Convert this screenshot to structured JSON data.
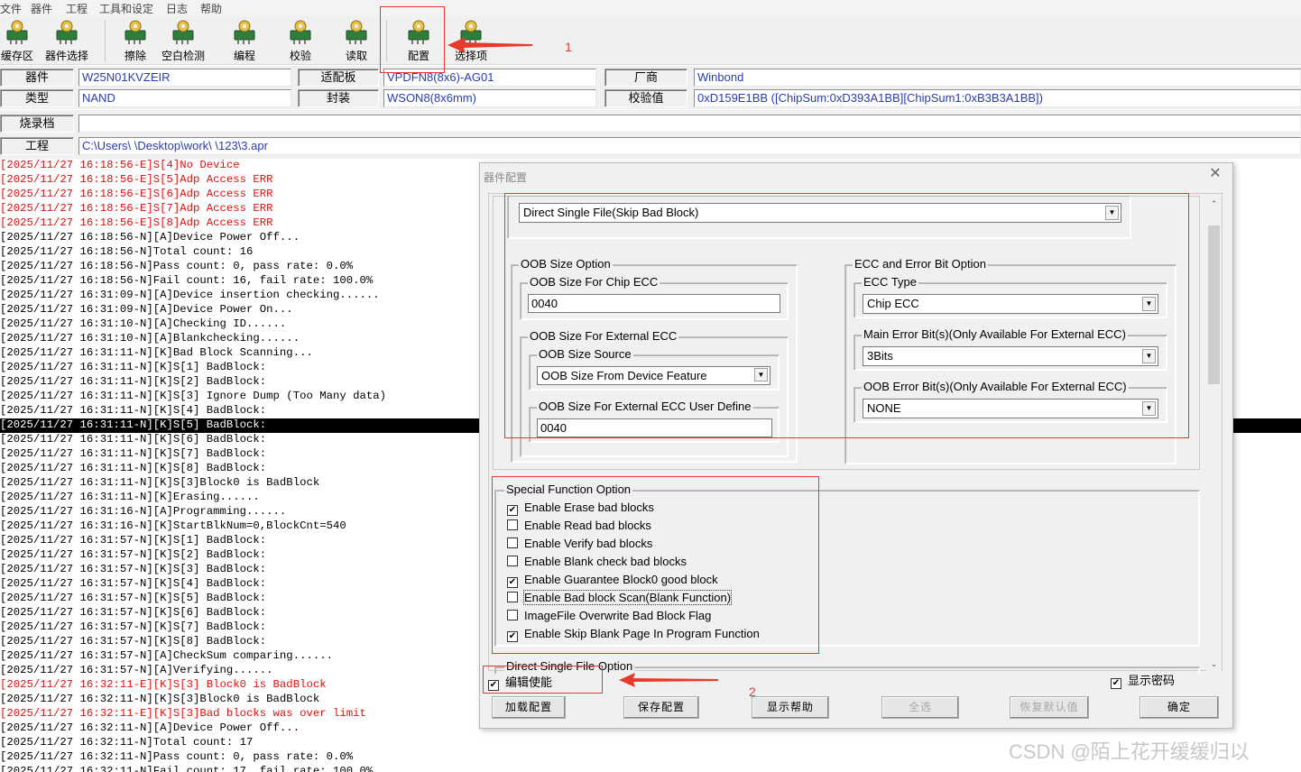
{
  "menubar": [
    "文件",
    "器件",
    "工程",
    "工具和设定",
    "日志",
    "帮助"
  ],
  "toolbar": [
    {
      "label": "缓存区",
      "icon": "buffer-icon"
    },
    {
      "label": "器件选择",
      "icon": "device-select-icon"
    },
    {
      "label": "擦除",
      "icon": "erase-icon"
    },
    {
      "label": "空白检测",
      "icon": "blank-check-icon"
    },
    {
      "label": "编程",
      "icon": "program-icon"
    },
    {
      "label": "校验",
      "icon": "verify-icon"
    },
    {
      "label": "读取",
      "icon": "read-icon"
    },
    {
      "label": "配置",
      "icon": "config-icon"
    },
    {
      "label": "选择项",
      "icon": "options-icon"
    }
  ],
  "info": {
    "device_label": "器件",
    "device_value": "W25N01KVZEIR",
    "adapter_label": "适配板",
    "adapter_value": "VPDFN8(8x6)-AG01",
    "maker_label": "厂商",
    "maker_value": "Winbond",
    "type_label": "类型",
    "type_value": "NAND",
    "package_label": "封装",
    "package_value": "WSON8(8x6mm)",
    "checksum_label": "校验值",
    "checksum_value": "0xD159E1BB    ([ChipSum:0xD393A1BB][ChipSum1:0xB3B3A1BB])",
    "burnfile_label": "烧录档",
    "project_label": "工程",
    "project_value": "C:\\Users\\      \\Desktop\\work\\      \\123\\3.apr"
  },
  "log": [
    {
      "t": "[2025/11/27 16:18:56-E]S[4]No Device",
      "k": "err"
    },
    {
      "t": "[2025/11/27 16:18:56-E]S[5]Adp Access ERR",
      "k": "err"
    },
    {
      "t": "[2025/11/27 16:18:56-E]S[6]Adp Access ERR",
      "k": "err"
    },
    {
      "t": "[2025/11/27 16:18:56-E]S[7]Adp Access ERR",
      "k": "err"
    },
    {
      "t": "[2025/11/27 16:18:56-E]S[8]Adp Access ERR",
      "k": "err"
    },
    {
      "t": "[2025/11/27 16:18:56-N][A]Device Power Off...",
      "k": ""
    },
    {
      "t": "[2025/11/27 16:18:56-N]Total count: 16",
      "k": ""
    },
    {
      "t": "[2025/11/27 16:18:56-N]Pass count: 0, pass rate: 0.0%",
      "k": ""
    },
    {
      "t": "[2025/11/27 16:18:56-N]Fail count: 16, fail rate: 100.0%",
      "k": ""
    },
    {
      "t": "[2025/11/27 16:31:09-N][A]Device insertion checking......",
      "k": ""
    },
    {
      "t": "[2025/11/27 16:31:09-N][A]Device Power On...",
      "k": ""
    },
    {
      "t": "[2025/11/27 16:31:10-N][A]Checking ID......",
      "k": ""
    },
    {
      "t": "[2025/11/27 16:31:10-N][A]Blankchecking......",
      "k": ""
    },
    {
      "t": "[2025/11/27 16:31:11-N][K]Bad Block Scanning...",
      "k": ""
    },
    {
      "t": "[2025/11/27 16:31:11-N][K]S[1] BadBlock:",
      "k": ""
    },
    {
      "t": "[2025/11/27 16:31:11-N][K]S[2] BadBlock:",
      "k": ""
    },
    {
      "t": "[2025/11/27 16:31:11-N][K]S[3] Ignore Dump (Too Many data)",
      "k": ""
    },
    {
      "t": "[2025/11/27 16:31:11-N][K]S[4] BadBlock:",
      "k": ""
    },
    {
      "t": "[2025/11/27 16:31:11-N][K]S[5] BadBlock:",
      "k": "sel"
    },
    {
      "t": "[2025/11/27 16:31:11-N][K]S[6] BadBlock:",
      "k": ""
    },
    {
      "t": "[2025/11/27 16:31:11-N][K]S[7] BadBlock:",
      "k": ""
    },
    {
      "t": "[2025/11/27 16:31:11-N][K]S[8] BadBlock:",
      "k": ""
    },
    {
      "t": "[2025/11/27 16:31:11-N][K]S[3]Block0 is BadBlock",
      "k": ""
    },
    {
      "t": "[2025/11/27 16:31:11-N][K]Erasing......",
      "k": ""
    },
    {
      "t": "[2025/11/27 16:31:16-N][A]Programming......",
      "k": ""
    },
    {
      "t": "[2025/11/27 16:31:16-N][K]StartBlkNum=0,BlockCnt=540",
      "k": ""
    },
    {
      "t": "[2025/11/27 16:31:57-N][K]S[1] BadBlock:",
      "k": ""
    },
    {
      "t": "[2025/11/27 16:31:57-N][K]S[2] BadBlock:",
      "k": ""
    },
    {
      "t": "[2025/11/27 16:31:57-N][K]S[3] BadBlock:",
      "k": ""
    },
    {
      "t": "[2025/11/27 16:31:57-N][K]S[4] BadBlock:",
      "k": ""
    },
    {
      "t": "[2025/11/27 16:31:57-N][K]S[5] BadBlock:",
      "k": ""
    },
    {
      "t": "[2025/11/27 16:31:57-N][K]S[6] BadBlock:",
      "k": ""
    },
    {
      "t": "[2025/11/27 16:31:57-N][K]S[7] BadBlock:",
      "k": ""
    },
    {
      "t": "[2025/11/27 16:31:57-N][K]S[8] BadBlock:",
      "k": ""
    },
    {
      "t": "[2025/11/27 16:31:57-N][A]CheckSum comparing......",
      "k": ""
    },
    {
      "t": "[2025/11/27 16:31:57-N][A]Verifying......",
      "k": ""
    },
    {
      "t": "[2025/11/27 16:32:11-E][K]S[3] Block0 is BadBlock",
      "k": "err"
    },
    {
      "t": "[2025/11/27 16:32:11-N][K]S[3]Block0 is BadBlock",
      "k": ""
    },
    {
      "t": "[2025/11/27 16:32:11-E][K]S[3]Bad blocks was over limit",
      "k": "err"
    },
    {
      "t": "[2025/11/27 16:32:11-N][A]Device Power Off...",
      "k": ""
    },
    {
      "t": "[2025/11/27 16:32:11-N]Total count: 17",
      "k": ""
    },
    {
      "t": "[2025/11/27 16:32:11-N]Pass count: 0, pass rate: 0.0%",
      "k": ""
    },
    {
      "t": "[2025/11/27 16:32:11-N]Fail count: 17, fail rate: 100.0%",
      "k": ""
    }
  ],
  "dialog": {
    "title": "器件配置",
    "close": "✕",
    "program_mode": "Direct Single File(Skip Bad Block)",
    "oob": {
      "title": "OOB Size Option",
      "chip_ecc_title": "OOB Size For Chip ECC",
      "chip_ecc_value": "0040",
      "ext_title": "OOB Size For External ECC",
      "source_title": "OOB Size Source",
      "source_value": "OOB Size From Device Feature",
      "user_title": "OOB Size For External ECC User Define",
      "user_value": "0040"
    },
    "ecc": {
      "title": "ECC and Error Bit Option",
      "type_title": "ECC Type",
      "type_value": "Chip ECC",
      "main_title": "Main Error Bit(s)(Only Available For External ECC)",
      "main_value": "3Bits",
      "oob_title": "OOB Error Bit(s)(Only Available For External ECC)",
      "oob_value": "NONE"
    },
    "special": {
      "title": "Special Function Option",
      "items": [
        {
          "label": "Enable Erase bad blocks",
          "checked": true
        },
        {
          "label": "Enable Read bad blocks",
          "checked": false
        },
        {
          "label": "Enable Verify bad blocks",
          "checked": false
        },
        {
          "label": "Enable Blank check bad blocks",
          "checked": false
        },
        {
          "label": "Enable Guarantee Block0 good block",
          "checked": true
        },
        {
          "label": "Enable Bad block Scan(Blank Function)",
          "checked": false
        },
        {
          "label": "ImageFile Overwrite Bad Block Flag",
          "checked": false
        },
        {
          "label": "Enable Skip Blank Page In Program Function",
          "checked": true
        }
      ]
    },
    "direct_title": "Direct Single File Option",
    "edit_enable": "编辑使能",
    "show_password": "显示密码",
    "buttons": {
      "load": "加载配置",
      "save": "保存配置",
      "help": "显示帮助",
      "select_all": "全选",
      "restore": "恢复默认值",
      "ok": "确定"
    }
  },
  "annotations": {
    "one": "1",
    "two": "2"
  },
  "watermark": "CSDN @陌上花开缓缓归以"
}
